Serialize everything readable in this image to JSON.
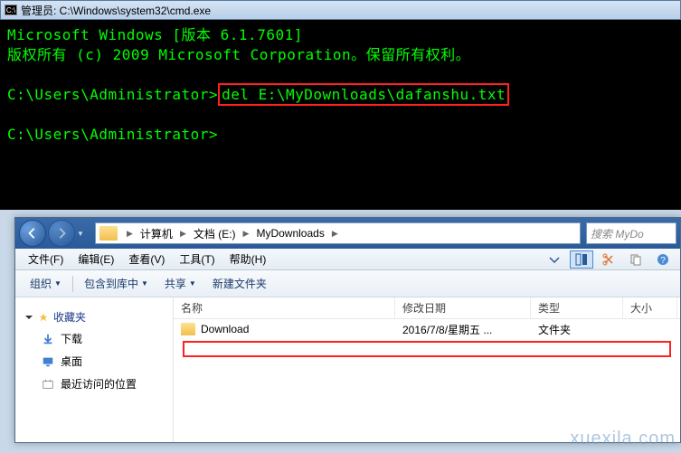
{
  "cmd": {
    "title": "管理员: C:\\Windows\\system32\\cmd.exe",
    "line1": "Microsoft Windows [版本 6.1.7601]",
    "line2": "版权所有 (c) 2009 Microsoft Corporation。保留所有权利。",
    "prompt1_prefix": "C:\\Users\\Administrator>",
    "prompt1_command": "del E:\\MyDownloads\\dafanshu.txt",
    "prompt2": "C:\\Users\\Administrator>"
  },
  "explorer": {
    "breadcrumb": {
      "items": [
        "计算机",
        "文档 (E:)",
        "MyDownloads"
      ]
    },
    "search": {
      "placeholder": "搜索 MyDo"
    },
    "menu": {
      "file": "文件(F)",
      "edit": "编辑(E)",
      "view": "查看(V)",
      "tools": "工具(T)",
      "help": "帮助(H)"
    },
    "toolbar": {
      "organize": "组织",
      "include": "包含到库中",
      "share": "共享",
      "newfolder": "新建文件夹"
    },
    "sidebar": {
      "favorites": "收藏夹",
      "downloads": "下载",
      "desktop": "桌面",
      "recent": "最近访问的位置"
    },
    "columns": {
      "name": "名称",
      "date": "修改日期",
      "type": "类型",
      "size": "大小"
    },
    "rows": [
      {
        "name": "Download",
        "date": "2016/7/8/星期五 ...",
        "type": "文件夹",
        "size": ""
      }
    ]
  },
  "watermark": "xuexila.com"
}
